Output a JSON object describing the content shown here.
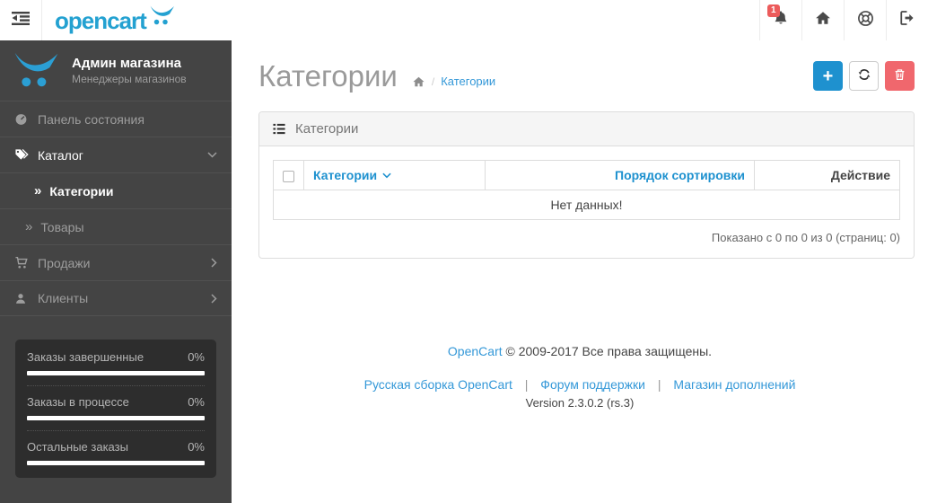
{
  "colors": {
    "accent_blue": "#1e91cf",
    "link_blue": "#3498d8",
    "logo_blue": "#23a1d1",
    "danger_red": "#f0676d",
    "badge_red": "#ec5b5b",
    "sidebar_bg": "#444444",
    "sidebar_text": "#9d9d9d",
    "stats_bg": "#2d2d2d"
  },
  "header": {
    "logo_text": "opencart",
    "notification_count": "1"
  },
  "sidebar": {
    "profile": {
      "name": "Админ магазина",
      "role": "Менеджеры магазинов"
    },
    "menu": {
      "dashboard": "Панель состояния",
      "catalog": "Каталог",
      "categories": "Категории",
      "products": "Товары",
      "sales": "Продажи",
      "customers": "Клиенты"
    },
    "stats": [
      {
        "label": "Заказы завершенные",
        "value": "0%"
      },
      {
        "label": "Заказы в процессе",
        "value": "0%"
      },
      {
        "label": "Остальные заказы",
        "value": "0%"
      }
    ]
  },
  "page": {
    "title": "Категории",
    "breadcrumb": {
      "current": "Категории",
      "separator": "/"
    }
  },
  "panel": {
    "title": "Категории",
    "columns": {
      "category": "Категории",
      "sort_order": "Порядок сортировки",
      "action": "Действие"
    },
    "empty_text": "Нет данных!",
    "pagination": "Показано с 0 по 0 из 0 (страниц: 0)"
  },
  "footer": {
    "copyright_link": "OpenCart",
    "copyright_text": "© 2009-2017 Все права защищены.",
    "link_build": "Русская сборка OpenCart",
    "link_forum": "Форум поддержки",
    "link_marketplace": "Магазин дополнений",
    "separator": "|",
    "version": "Version 2.3.0.2 (rs.3)"
  },
  "icons": {
    "angle_double_right": "»",
    "plus": "+"
  }
}
